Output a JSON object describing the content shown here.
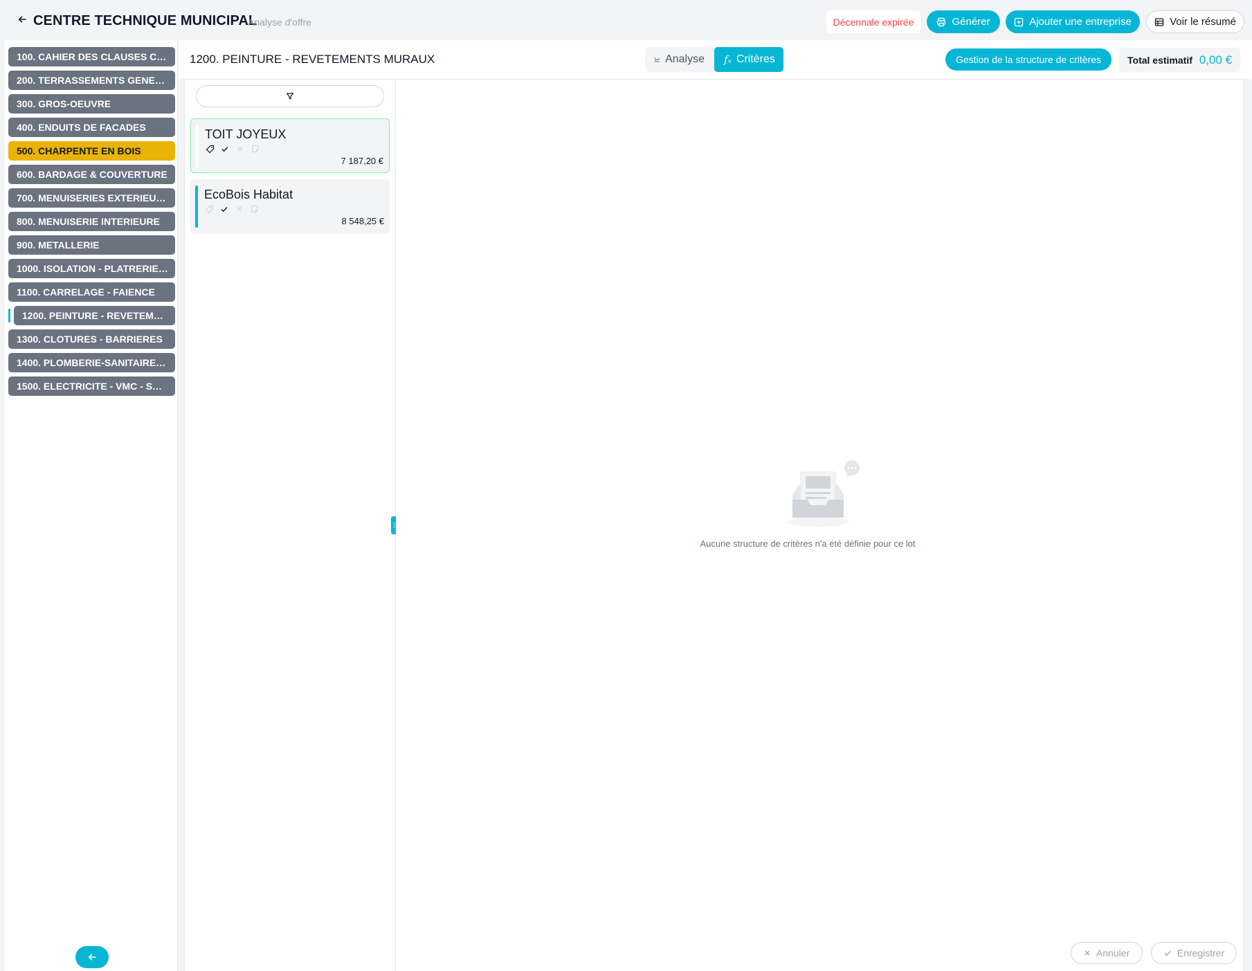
{
  "header": {
    "title": "CENTRE TECHNIQUE MUNICIPAL",
    "subtitle": "Analyse d'offre",
    "expired_label": "Décennale expirée",
    "generate_label": "Générer",
    "add_company_label": "Ajouter une entreprise",
    "summary_label": "Voir le résumé"
  },
  "sidebar": {
    "lots": [
      {
        "label": "100. CAHIER DES CLAUSES COMMUNES"
      },
      {
        "label": "200. TERRASSEMENTS GENERAUX"
      },
      {
        "label": "300. GROS-OEUVRE"
      },
      {
        "label": "400. ENDUITS DE FACADES"
      },
      {
        "label": "500. CHARPENTE EN BOIS"
      },
      {
        "label": "600. BARDAGE & COUVERTURE"
      },
      {
        "label": "700. MENUISERIES EXTERIEURES"
      },
      {
        "label": "800. MENUISERIE INTERIEURE"
      },
      {
        "label": "900. METALLERIE"
      },
      {
        "label": "1000. ISOLATION - PLATRERIE - PLAFONDS"
      },
      {
        "label": "1100. CARRELAGE - FAIENCE"
      },
      {
        "label": "1200. PEINTURE - REVETEMENTS MURAUX"
      },
      {
        "label": "1300. CLOTURES - BARRIERES"
      },
      {
        "label": "1400. PLOMBERIE-SANITAIRE - CHAUFFAGE"
      },
      {
        "label": "1500. ELECTRICITE - VMC - SECURITE"
      }
    ],
    "active_index": 11,
    "highlight_index": 4
  },
  "main": {
    "lot_title": "1200. PEINTURE - REVETEMENTS MURAUX",
    "tabs": [
      {
        "label": "Analyse",
        "icon": "chart-line-icon",
        "active": false
      },
      {
        "label": "Critères",
        "icon": "function-icon",
        "active": true
      }
    ],
    "manage_label": "Gestion de la structure de critères",
    "total_label": "Total estimatif",
    "total_value": "0,00 €"
  },
  "companies": [
    {
      "name": "TOIT JOYEUX",
      "price": "7 187,20 €",
      "selected": true,
      "bar_color": "#f3f4f6"
    },
    {
      "name": "EcoBois Habitat",
      "price": "8 548,25 €",
      "selected": false,
      "bar_color": "#06b6d4"
    }
  ],
  "content": {
    "empty_text": "Aucune structure de critères n'a été définie pour ce lot",
    "cancel_label": "Annuler",
    "save_label": "Enregistrer"
  },
  "colors": {
    "accent": "#06b6d4",
    "lot": "#6b7280",
    "lot_highlight": "#eab308",
    "danger": "#ef4444"
  }
}
